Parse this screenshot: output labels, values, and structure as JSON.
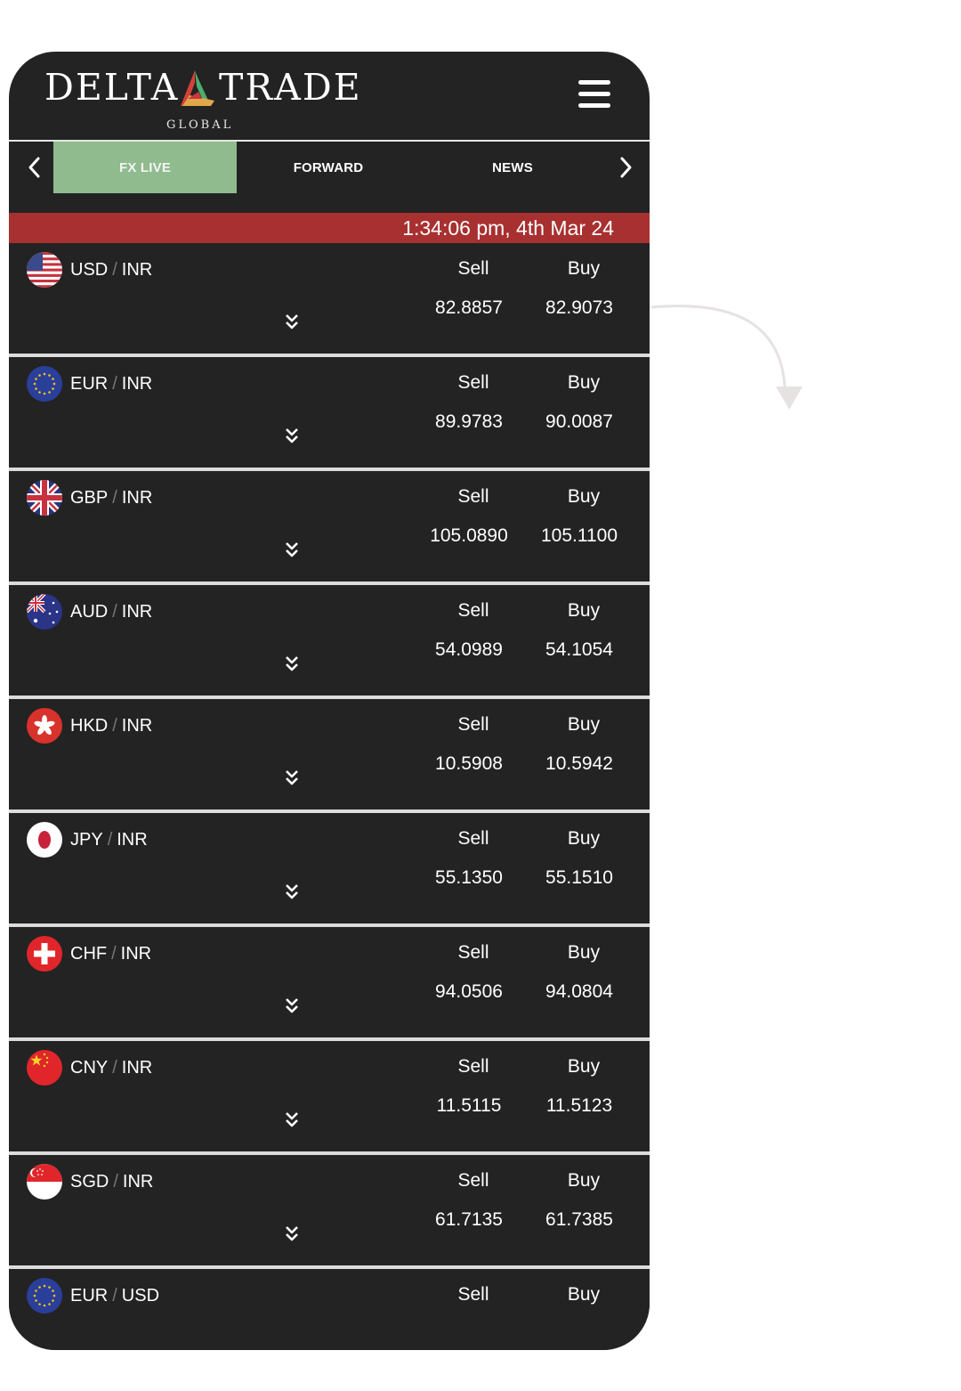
{
  "app": {
    "logo_left": "DELTA",
    "logo_right": "TRADE",
    "logo_sub": "GLOBAL",
    "brand_colors": {
      "red": "#d6403a",
      "green": "#4cae6b",
      "gold": "#e2a64a"
    }
  },
  "tabs": [
    {
      "label": "FX LIVE",
      "active": true
    },
    {
      "label": "FORWARD",
      "active": false
    },
    {
      "label": "NEWS",
      "active": false
    }
  ],
  "timestamp": "1:34:06 pm, 4th Mar 24",
  "colors": {
    "panel": "#232323",
    "active_tab": "#8fbb8f",
    "time_bar": "#a83030"
  },
  "rates": [
    {
      "base": "USD",
      "quote": "INR",
      "flag": "us-flag-icon",
      "sell_label": "Sell",
      "buy_label": "Buy",
      "sell": "82.8857",
      "buy": "82.9073"
    },
    {
      "base": "EUR",
      "quote": "INR",
      "flag": "eu-flag-icon",
      "sell_label": "Sell",
      "buy_label": "Buy",
      "sell": "89.9783",
      "buy": "90.0087"
    },
    {
      "base": "GBP",
      "quote": "INR",
      "flag": "uk-flag-icon",
      "sell_label": "Sell",
      "buy_label": "Buy",
      "sell": "105.0890",
      "buy": "105.1100"
    },
    {
      "base": "AUD",
      "quote": "INR",
      "flag": "au-flag-icon",
      "sell_label": "Sell",
      "buy_label": "Buy",
      "sell": "54.0989",
      "buy": "54.1054"
    },
    {
      "base": "HKD",
      "quote": "INR",
      "flag": "hk-flag-icon",
      "sell_label": "Sell",
      "buy_label": "Buy",
      "sell": "10.5908",
      "buy": "10.5942"
    },
    {
      "base": "JPY",
      "quote": "INR",
      "flag": "jp-flag-icon",
      "sell_label": "Sell",
      "buy_label": "Buy",
      "sell": "55.1350",
      "buy": "55.1510"
    },
    {
      "base": "CHF",
      "quote": "INR",
      "flag": "ch-flag-icon",
      "sell_label": "Sell",
      "buy_label": "Buy",
      "sell": "94.0506",
      "buy": "94.0804"
    },
    {
      "base": "CNY",
      "quote": "INR",
      "flag": "cn-flag-icon",
      "sell_label": "Sell",
      "buy_label": "Buy",
      "sell": "11.5115",
      "buy": "11.5123"
    },
    {
      "base": "SGD",
      "quote": "INR",
      "flag": "sg-flag-icon",
      "sell_label": "Sell",
      "buy_label": "Buy",
      "sell": "61.7135",
      "buy": "61.7385"
    },
    {
      "base": "EUR",
      "quote": "USD",
      "flag": "eu-flag-icon",
      "sell_label": "Sell",
      "buy_label": "Buy",
      "sell": "",
      "buy": ""
    }
  ]
}
